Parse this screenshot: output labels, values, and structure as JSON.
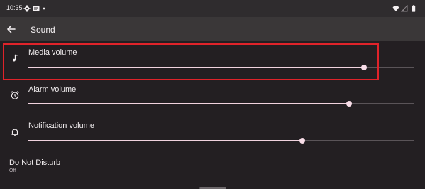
{
  "status_bar": {
    "time": "10:35",
    "icons": [
      "settings-gear-icon",
      "message-icon",
      "dot-icon",
      "wifi-icon",
      "signal-icon",
      "battery-icon"
    ]
  },
  "app_bar": {
    "back_icon": "arrow-back-icon",
    "title": "Sound"
  },
  "volume_rows": [
    {
      "icon": "music-note-icon",
      "label": "Media volume",
      "level": 0.87
    },
    {
      "icon": "alarm-clock-icon",
      "label": "Alarm volume",
      "level": 0.83
    },
    {
      "icon": "bell-icon",
      "label": "Notification volume",
      "level": 0.71
    }
  ],
  "do_not_disturb": {
    "title": "Do Not Disturb",
    "status": "Off"
  },
  "colors": {
    "background": "#231f22",
    "app_bar": "#3a3738",
    "status_bar": "#2f2c2e",
    "slider_active": "#f1d3df",
    "slider_inactive": "#5a5458",
    "highlight": "#e0232a"
  }
}
